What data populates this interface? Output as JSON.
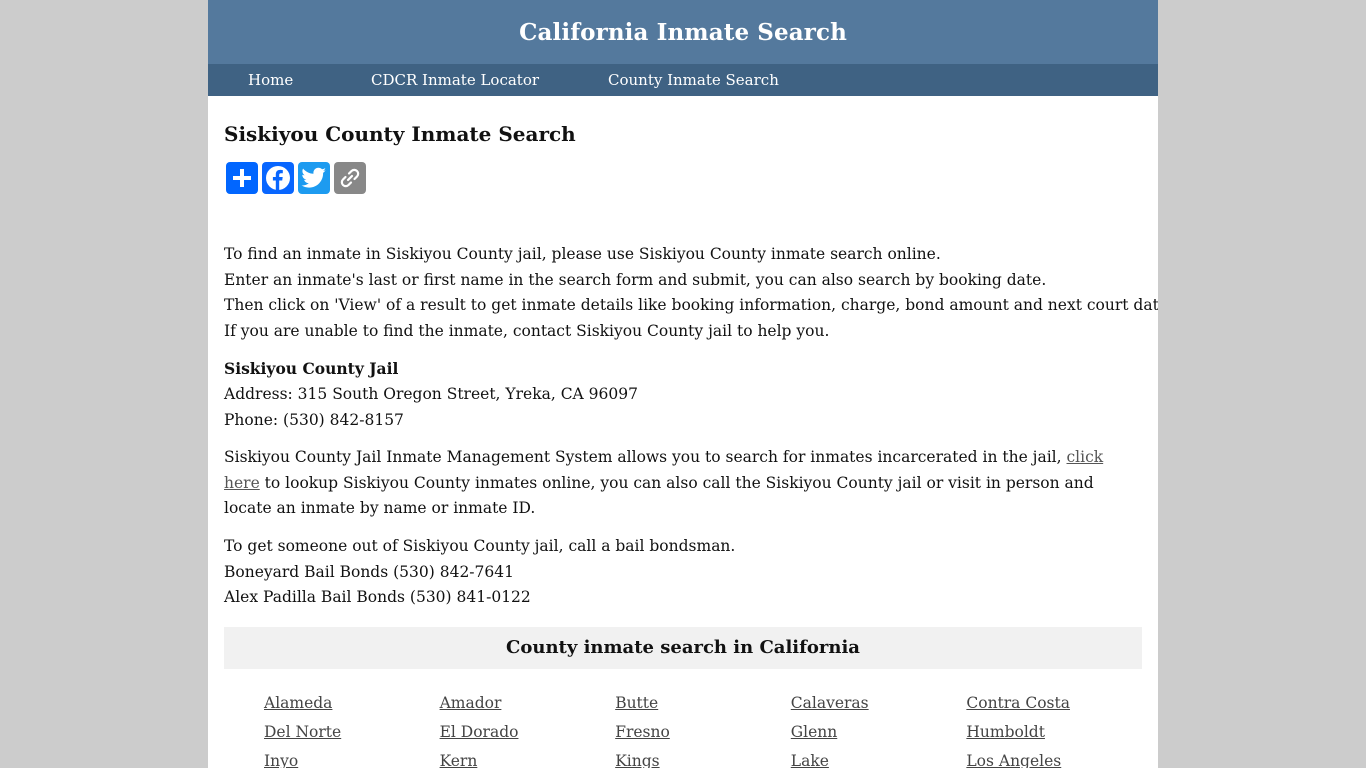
{
  "header": {
    "site_title": "California Inmate Search"
  },
  "nav": {
    "items": [
      {
        "label": "Home"
      },
      {
        "label": "CDCR Inmate Locator"
      },
      {
        "label": "County Inmate Search"
      }
    ]
  },
  "main": {
    "page_title": "Siskiyou County Inmate Search",
    "share_buttons": [
      {
        "icon": "share-plus-icon",
        "color": "#0166ff"
      },
      {
        "icon": "facebook-icon",
        "color": "#0866ff"
      },
      {
        "icon": "twitter-icon",
        "color": "#1d9bf0"
      },
      {
        "icon": "copy-link-icon",
        "color": "#888888"
      }
    ],
    "intro_lines": [
      "To find an inmate in Siskiyou County jail, please use Siskiyou County inmate search online.",
      "Enter an inmate's last or first name in the search form and submit, you can also search by booking date.",
      "Then click on 'View' of a result to get inmate details like booking information, charge, bond amount and next court date.",
      "If you are unable to find the inmate, contact Siskiyou County jail to help you."
    ],
    "jail": {
      "name": "Siskiyou County Jail",
      "address": "Address: 315 South Oregon Street, Yreka, CA 96097",
      "phone": "Phone: (530) 842-8157"
    },
    "ims_paragraph": {
      "before_link": "Siskiyou County Jail Inmate Management System allows you to search for inmates incarcerated in the jail, ",
      "link_text": "click here",
      "after_link": " to lookup Siskiyou County inmates online, you can also call the Siskiyou County jail or visit in person and locate an inmate by name or inmate ID."
    },
    "bail": {
      "intro": "To get someone out of Siskiyou County jail, call a bail bondsman.",
      "bondsmen": [
        "Boneyard Bail Bonds (530) 842-7641",
        "Alex Padilla Bail Bonds (530) 841-0122"
      ]
    },
    "county_section": {
      "heading": "County inmate search in California",
      "counties": [
        "Alameda",
        "Amador",
        "Butte",
        "Calaveras",
        "Contra Costa",
        "Del Norte",
        "El Dorado",
        "Fresno",
        "Glenn",
        "Humboldt",
        "Inyo",
        "Kern",
        "Kings",
        "Lake",
        "Los Angeles"
      ]
    }
  },
  "colors": {
    "header_bg": "#54799d",
    "nav_bg": "#3f6283",
    "page_bg": "#cccccc",
    "county_box_bg": "#f1f1f1"
  }
}
